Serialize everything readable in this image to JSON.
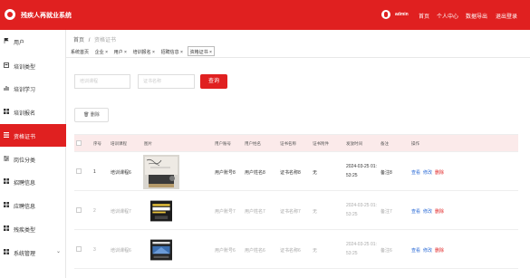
{
  "app": {
    "title": "残疾人再就业系统"
  },
  "header": {
    "username": "admin",
    "nav": [
      "首页",
      "个人中心",
      "数据导出",
      "退出登录"
    ]
  },
  "sidebar": {
    "items": [
      {
        "label": "用户",
        "icon": "flag-icon",
        "active": false
      },
      {
        "label": "培训类型",
        "icon": "box-icon",
        "active": false
      },
      {
        "label": "培训学习",
        "icon": "bar-chart-icon",
        "active": false
      },
      {
        "label": "培训报名",
        "icon": "grid-icon",
        "active": false
      },
      {
        "label": "资格证书",
        "icon": "list-icon",
        "active": true
      },
      {
        "label": "岗位分类",
        "icon": "sliders-icon",
        "active": false
      },
      {
        "label": "招聘信息",
        "icon": "grid-icon",
        "active": false
      },
      {
        "label": "应聘信息",
        "icon": "grid-icon",
        "active": false
      },
      {
        "label": "残疾类型",
        "icon": "grid-icon",
        "active": false
      },
      {
        "label": "系统管理",
        "icon": "grid-icon",
        "active": false
      }
    ]
  },
  "breadcrumb": {
    "home": "首页",
    "sep": "/",
    "current": "资格证书"
  },
  "tabs": [
    "系统首页",
    "企业 ×",
    "用户 ×",
    "培训报名 ×",
    "招聘信息 ×",
    "资格证书 ×"
  ],
  "search": {
    "field1_placeholder": "培训课程",
    "field2_placeholder": "证书名称",
    "button": "查询"
  },
  "actions": {
    "delete_label": "删除",
    "delete_icon": "trash-icon"
  },
  "table": {
    "headers": [
      "序号",
      "培训课程",
      "图片",
      "用户账号",
      "用户姓名",
      "证书名称",
      "证书附件",
      "发放时间",
      "备注",
      "操作"
    ],
    "rows": [
      {
        "index": "1",
        "course": "培训课程6",
        "account": "用户账号8",
        "name": "用户姓名8",
        "cert": "证书名称8",
        "attach": "无",
        "time1": "2024-03-25 01:",
        "time2": "53:25",
        "note": "备注8"
      },
      {
        "index": "2",
        "course": "培训课程7",
        "account": "用户账号7",
        "name": "用户姓名7",
        "cert": "证书名称7",
        "attach": "无",
        "time1": "2024-03-25 01:",
        "time2": "53:25",
        "note": "备注7"
      },
      {
        "index": "3",
        "course": "培训课程6",
        "account": "用户账号6",
        "name": "用户姓名6",
        "cert": "证书名称6",
        "attach": "无",
        "time1": "2024-03-25 01:",
        "time2": "53:25",
        "note": "备注6"
      }
    ],
    "row_actions": {
      "view": "查看",
      "edit": "修改",
      "delete": "删除"
    }
  },
  "colors": {
    "brand": "#e02020",
    "link": "#2b6bd6",
    "header_row": "#fbeaea"
  }
}
